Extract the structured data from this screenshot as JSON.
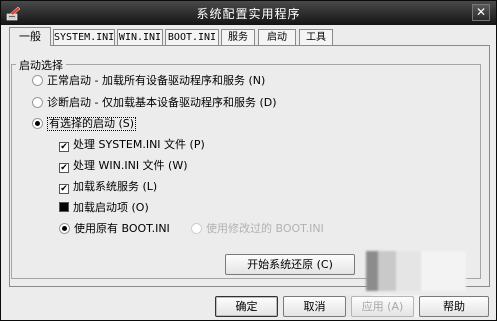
{
  "window": {
    "title": "系统配置实用程序",
    "close_glyph": "✕"
  },
  "tabs": [
    {
      "label": "一般",
      "active": true
    },
    {
      "label": "SYSTEM.INI"
    },
    {
      "label": "WIN.INI"
    },
    {
      "label": "BOOT.INI"
    },
    {
      "label": "服务"
    },
    {
      "label": "启动"
    },
    {
      "label": "工具"
    }
  ],
  "startup_group": {
    "label": "启动选择",
    "normal": "正常启动 - 加载所有设备驱动程序和服务 (N)",
    "diagnostic": "诊断启动 - 仅加载基本设备驱动程序和服务 (D)",
    "selective": "有选择的启动 (S)",
    "selected_option": "selective",
    "options": {
      "process_system_ini": {
        "label": "处理 SYSTEM.INI 文件 (P)",
        "checked": true
      },
      "process_win_ini": {
        "label": "处理 WIN.INI 文件 (W)",
        "checked": true
      },
      "load_services": {
        "label": "加载系统服务 (L)",
        "checked": true
      },
      "load_startup_items": {
        "label": "加载启动项 (O)",
        "checked": "indeterminate"
      }
    },
    "boot_ini": {
      "original": "使用原有 BOOT.INI",
      "modified": "使用修改过的 BOOT.INI",
      "selected": "original"
    }
  },
  "buttons": {
    "restore": "开始系统还原 (C)",
    "ok": "确定",
    "cancel": "取消",
    "apply": "应用 (A)",
    "help": "帮助"
  },
  "colors": {
    "titlebar": "#141414",
    "window_bg": "#ececec"
  }
}
